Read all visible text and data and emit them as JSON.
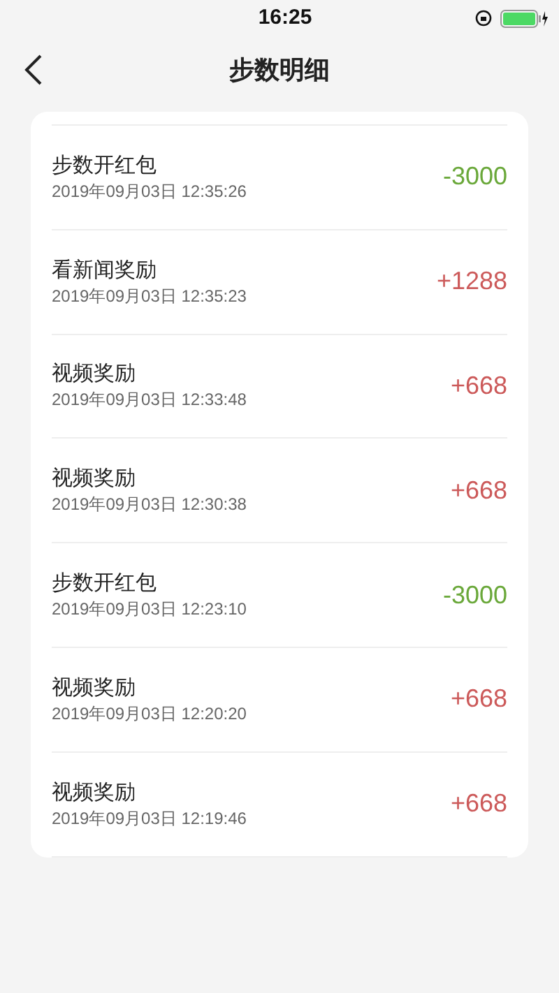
{
  "status_bar": {
    "time": "16:25"
  },
  "header": {
    "title": "步数明细"
  },
  "records": [
    {
      "title": "步数开红包",
      "time": "2019年09月03日 12:35:26",
      "amount": "-3000",
      "kind": "expense"
    },
    {
      "title": "看新闻奖励",
      "time": "2019年09月03日 12:35:23",
      "amount": "+1288",
      "kind": "income"
    },
    {
      "title": "视频奖励",
      "time": "2019年09月03日 12:33:48",
      "amount": "+668",
      "kind": "income"
    },
    {
      "title": "视频奖励",
      "time": "2019年09月03日 12:30:38",
      "amount": "+668",
      "kind": "income"
    },
    {
      "title": "步数开红包",
      "time": "2019年09月03日 12:23:10",
      "amount": "-3000",
      "kind": "expense"
    },
    {
      "title": "视频奖励",
      "time": "2019年09月03日 12:20:20",
      "amount": "+668",
      "kind": "income"
    },
    {
      "title": "视频奖励",
      "time": "2019年09月03日 12:19:46",
      "amount": "+668",
      "kind": "income"
    }
  ]
}
